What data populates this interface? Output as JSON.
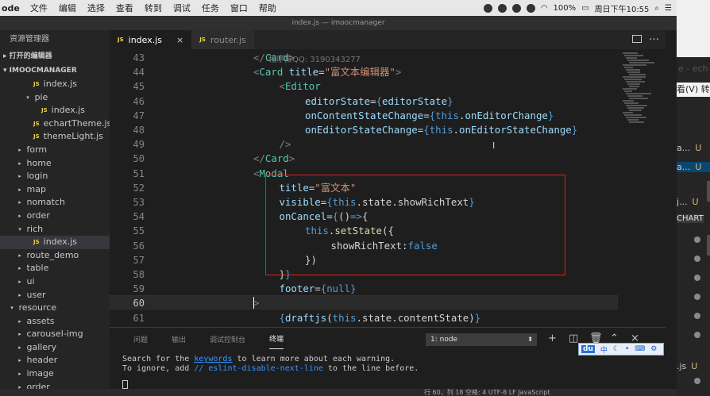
{
  "menubar": {
    "app_name": "ode",
    "menu_items": [
      "文件",
      "编辑",
      "选择",
      "查看",
      "转到",
      "调试",
      "任务",
      "窗口",
      "帮助"
    ],
    "battery": "100%",
    "clock": "周日下午10:55"
  },
  "window": {
    "title": "index.js — imoocmanager"
  },
  "sidebar": {
    "title": "资源管理器",
    "open_editors_label": "打开的编辑器",
    "project_label": "IMOOCMANAGER",
    "items": [
      {
        "label": "index.js",
        "type": "file",
        "depth": 3
      },
      {
        "label": "pie",
        "type": "folder-open",
        "depth": 3
      },
      {
        "label": "index.js",
        "type": "file",
        "depth": 4
      },
      {
        "label": "echartTheme.js",
        "type": "file",
        "depth": 3
      },
      {
        "label": "themeLight.js",
        "type": "file",
        "depth": 3
      },
      {
        "label": "form",
        "type": "folder",
        "depth": 2
      },
      {
        "label": "home",
        "type": "folder",
        "depth": 2
      },
      {
        "label": "login",
        "type": "folder",
        "depth": 2
      },
      {
        "label": "map",
        "type": "folder",
        "depth": 2
      },
      {
        "label": "nomatch",
        "type": "folder",
        "depth": 2
      },
      {
        "label": "order",
        "type": "folder",
        "depth": 2
      },
      {
        "label": "rich",
        "type": "folder-open",
        "depth": 2
      },
      {
        "label": "index.js",
        "type": "file",
        "depth": 3,
        "selected": true
      },
      {
        "label": "route_demo",
        "type": "folder",
        "depth": 2
      },
      {
        "label": "table",
        "type": "folder",
        "depth": 2
      },
      {
        "label": "ui",
        "type": "folder",
        "depth": 2
      },
      {
        "label": "user",
        "type": "folder",
        "depth": 2
      },
      {
        "label": "resource",
        "type": "folder-open",
        "depth": 1
      },
      {
        "label": "assets",
        "type": "folder",
        "depth": 2
      },
      {
        "label": "carousel-img",
        "type": "folder",
        "depth": 2
      },
      {
        "label": "gallery",
        "type": "folder",
        "depth": 2
      },
      {
        "label": "header",
        "type": "folder",
        "depth": 2
      },
      {
        "label": "image",
        "type": "folder",
        "depth": 2
      },
      {
        "label": "order",
        "type": "folder",
        "depth": 2
      }
    ]
  },
  "tabs": [
    {
      "label": "index.js",
      "active": true,
      "close": "×"
    },
    {
      "label": "router.js",
      "active": false
    }
  ],
  "editor": {
    "watermark": "程序猿QQ: 3190343277",
    "current_line": 60,
    "lines": [
      {
        "n": 43,
        "tokens": [
          [
            "t-br",
            "</"
          ],
          [
            "t-tag",
            "Card"
          ],
          [
            "t-br",
            ">"
          ]
        ],
        "indent": 3
      },
      {
        "n": 44,
        "tokens": [
          [
            "t-br",
            "<"
          ],
          [
            "t-tag",
            "Card "
          ],
          [
            "t-attr",
            "title"
          ],
          [
            "t-txt",
            "="
          ],
          [
            "t-str",
            "\"富文本编辑器\""
          ],
          [
            "t-br",
            ">"
          ]
        ],
        "indent": 3
      },
      {
        "n": 45,
        "tokens": [
          [
            "t-br",
            "<"
          ],
          [
            "t-tag",
            "Editor"
          ]
        ],
        "indent": 4
      },
      {
        "n": 46,
        "tokens": [
          [
            "t-attr",
            "editorState"
          ],
          [
            "t-txt",
            "="
          ],
          [
            "t-brace",
            "{"
          ],
          [
            "t-attr",
            "editorState"
          ],
          [
            "t-brace",
            "}"
          ]
        ],
        "indent": 5
      },
      {
        "n": 47,
        "tokens": [
          [
            "t-attr",
            "onContentStateChange"
          ],
          [
            "t-txt",
            "="
          ],
          [
            "t-brace",
            "{"
          ],
          [
            "t-kw",
            "this"
          ],
          [
            "t-txt",
            "."
          ],
          [
            "t-attr",
            "onEditorChange"
          ],
          [
            "t-brace",
            "}"
          ]
        ],
        "indent": 5
      },
      {
        "n": 48,
        "tokens": [
          [
            "t-attr",
            "onEditorStateChange"
          ],
          [
            "t-txt",
            "="
          ],
          [
            "t-brace",
            "{"
          ],
          [
            "t-kw",
            "this"
          ],
          [
            "t-txt",
            "."
          ],
          [
            "t-attr",
            "onEditorStateChange"
          ],
          [
            "t-brace",
            "}"
          ]
        ],
        "indent": 5
      },
      {
        "n": 49,
        "tokens": [
          [
            "t-br",
            "/>"
          ]
        ],
        "indent": 4
      },
      {
        "n": 50,
        "tokens": [
          [
            "t-br",
            "</"
          ],
          [
            "t-tag",
            "Card"
          ],
          [
            "t-br",
            ">"
          ]
        ],
        "indent": 3
      },
      {
        "n": 51,
        "tokens": [
          [
            "t-br",
            "<"
          ],
          [
            "t-tag",
            "Modal"
          ]
        ],
        "indent": 3
      },
      {
        "n": 52,
        "tokens": [
          [
            "t-attr",
            "title"
          ],
          [
            "t-txt",
            "="
          ],
          [
            "t-str",
            "\"富文本\""
          ]
        ],
        "indent": 4
      },
      {
        "n": 53,
        "tokens": [
          [
            "t-attr",
            "visible"
          ],
          [
            "t-txt",
            "="
          ],
          [
            "t-brace",
            "{"
          ],
          [
            "t-kw",
            "this"
          ],
          [
            "t-txt",
            ".state.showRichText"
          ],
          [
            "t-brace",
            "}"
          ]
        ],
        "indent": 4
      },
      {
        "n": 54,
        "tokens": [
          [
            "t-attr",
            "onCancel"
          ],
          [
            "t-txt",
            "="
          ],
          [
            "t-brace",
            "{"
          ],
          [
            "t-txt",
            "()"
          ],
          [
            "t-kw",
            "=>"
          ],
          [
            "t-txt",
            "{"
          ]
        ],
        "indent": 4
      },
      {
        "n": 55,
        "tokens": [
          [
            "t-kw",
            "this"
          ],
          [
            "t-txt",
            "."
          ],
          [
            "t-fn",
            "setState"
          ],
          [
            "t-txt",
            "({"
          ]
        ],
        "indent": 5
      },
      {
        "n": 56,
        "tokens": [
          [
            "t-txt",
            "showRichText:"
          ],
          [
            "t-kw",
            "false"
          ]
        ],
        "indent": 6
      },
      {
        "n": 57,
        "tokens": [
          [
            "t-txt",
            "})"
          ]
        ],
        "indent": 5
      },
      {
        "n": 58,
        "tokens": [
          [
            "t-txt",
            "}"
          ],
          [
            "t-brace",
            "}"
          ]
        ],
        "indent": 4
      },
      {
        "n": 59,
        "tokens": [
          [
            "t-attr",
            "footer"
          ],
          [
            "t-txt",
            "="
          ],
          [
            "t-brace",
            "{"
          ],
          [
            "t-kw",
            "null"
          ],
          [
            "t-brace",
            "}"
          ]
        ],
        "indent": 4
      },
      {
        "n": 60,
        "tokens": [
          [
            "t-br",
            ">"
          ]
        ],
        "indent": 3
      },
      {
        "n": 61,
        "tokens": [
          [
            "t-brace",
            "{"
          ],
          [
            "t-attr",
            "draftjs"
          ],
          [
            "t-txt",
            "("
          ],
          [
            "t-kw",
            "this"
          ],
          [
            "t-txt",
            ".state.contentState)"
          ],
          [
            "t-brace",
            "}"
          ]
        ],
        "indent": 4
      }
    ]
  },
  "panel": {
    "tabs": [
      {
        "label": "问题",
        "active": false
      },
      {
        "label": "输出",
        "active": false
      },
      {
        "label": "调试控制台",
        "active": false
      },
      {
        "label": "终端",
        "active": true
      }
    ],
    "terminal_select": "1: node",
    "terminal_lines": [
      {
        "parts": [
          [
            "",
            "Search for the "
          ],
          [
            "link",
            "keywords"
          ],
          [
            "",
            " to learn more about each warning."
          ]
        ]
      },
      {
        "parts": [
          [
            "",
            "To ignore, add "
          ],
          [
            "cm",
            "// eslint-disable-next-line"
          ],
          [
            "",
            " to the line before."
          ]
        ]
      }
    ],
    "ime": {
      "logo": "du",
      "lang": "中"
    }
  },
  "right_window": {
    "title_fragment": "e - ech",
    "menu_fragment": "看(V)  转",
    "rows": [
      {
        "label": "a...",
        "status": "U",
        "highlight": false
      },
      {
        "label": "a...",
        "status": "U",
        "highlight": true
      },
      {
        "label": "j...",
        "status": "U",
        "highlight": false
      },
      {
        "label": "CHART",
        "status": "",
        "highlight": false
      },
      {
        "label": ".js",
        "status": "U",
        "highlight": false
      }
    ]
  },
  "statusbar": {
    "text": "行 60，列 18   空格: 4   UTF-8   LF   JavaScript"
  }
}
